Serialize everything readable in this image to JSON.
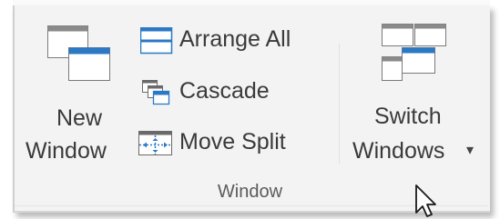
{
  "ribbon": {
    "group_label": "Window",
    "new_window": {
      "line1": "New",
      "line2": "Window",
      "icon": "new-window-icon"
    },
    "arrange_all": {
      "label": "Arrange All",
      "icon": "arrange-all-icon"
    },
    "cascade": {
      "label": "Cascade",
      "icon": "cascade-icon"
    },
    "move_split": {
      "label": "Move Split",
      "icon": "move-split-icon"
    },
    "switch_windows": {
      "line1": "Switch",
      "line2": "Windows",
      "dropdown": "▾",
      "icon": "switch-windows-icon"
    }
  },
  "colors": {
    "accent": "#2b78c5",
    "text": "#3a3a3a",
    "ribbon_bg": "#f3f3f3"
  }
}
